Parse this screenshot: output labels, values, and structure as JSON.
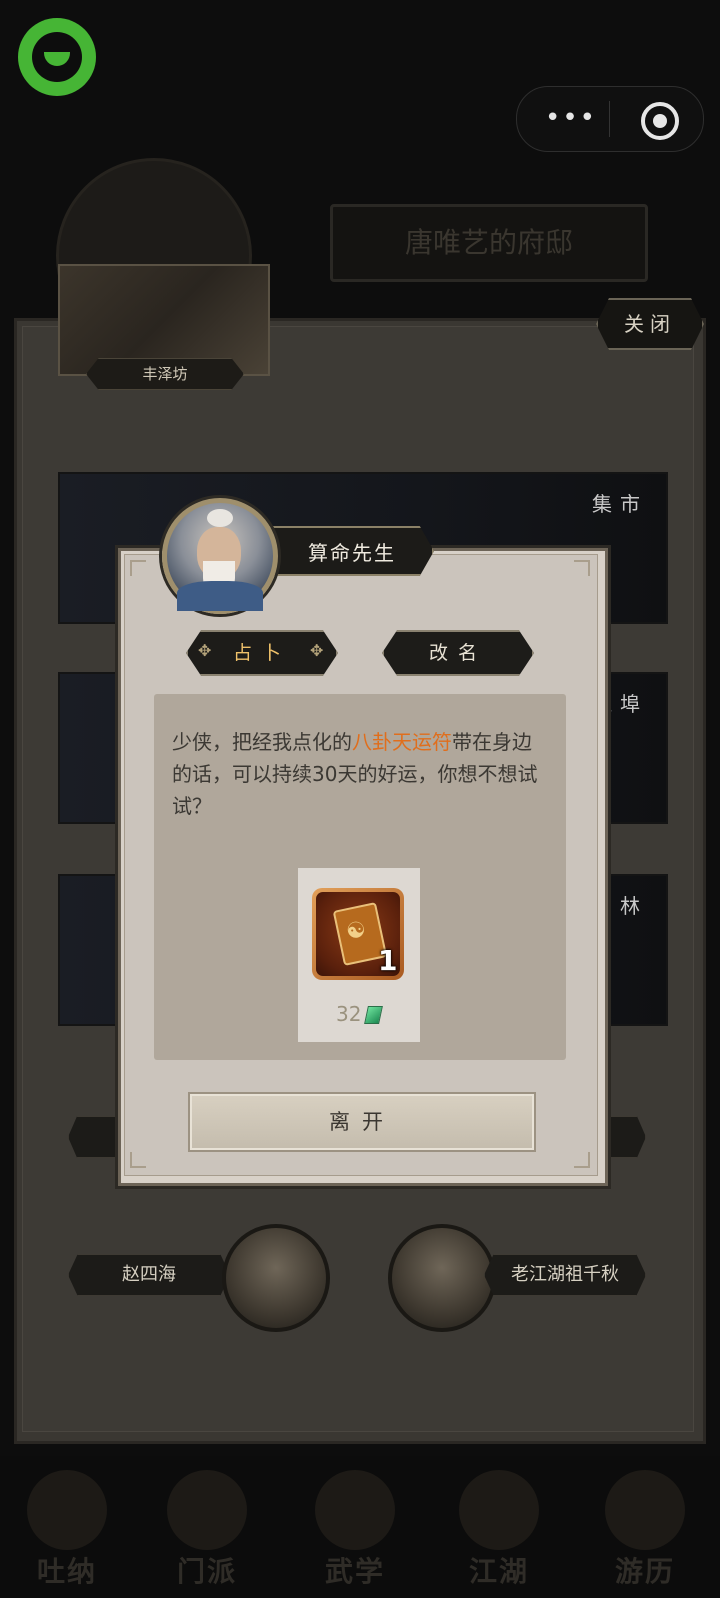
{
  "top_bar": {
    "logo_icon": "wechat-mini-program-logo",
    "menu_icon": "more-dots-icon",
    "close_icon": "target-circle-icon"
  },
  "background": {
    "header_title": "唐唯艺的府邸",
    "header_subtitle": "",
    "close_label": "关闭",
    "map_label": "丰泽坊",
    "locations": [
      {
        "name": "集市"
      },
      {
        "name": "江埠"
      },
      {
        "name": "园林"
      }
    ],
    "npcs": [
      {
        "name": "赵四海"
      },
      {
        "name": "老江湖祖千秋"
      }
    ],
    "bottom_nav": [
      "吐纳",
      "门派",
      "武学",
      "江湖",
      "游历"
    ]
  },
  "dialog": {
    "npc_name": "算命先生",
    "tabs": [
      {
        "label": "占卜",
        "active": true
      },
      {
        "label": "改名",
        "active": false
      }
    ],
    "message_before": "少侠，把经我点化的",
    "message_highlight": "八卦天运符",
    "message_after": "带在身边的话，可以持续30天的好运，你想不想试试？",
    "item": {
      "icon": "bagua-talisman-icon",
      "count": "1",
      "price": "32",
      "currency_icon": "jade-gem-icon"
    },
    "leave_label": "离开"
  },
  "colors": {
    "accent_brand": "#46b535",
    "highlight": "#e06e1c",
    "active_tab": "#efc16a"
  }
}
